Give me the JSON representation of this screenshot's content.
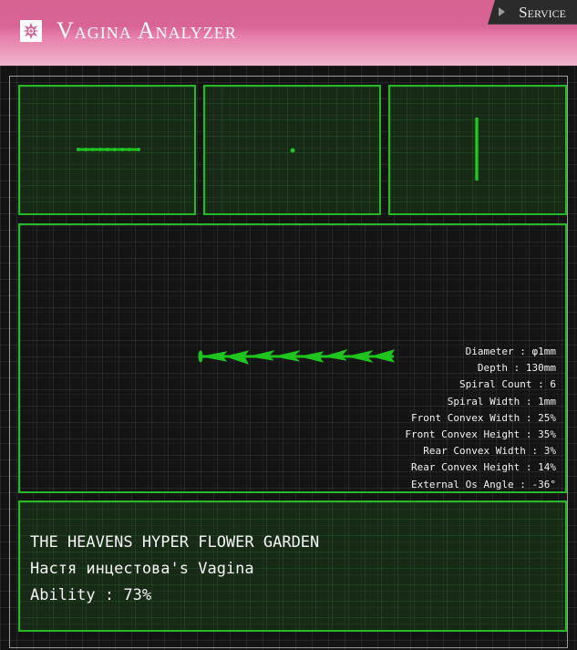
{
  "header": {
    "title": "Vagina Analyzer",
    "logo_icon": "flower-star-icon",
    "service_label": "Service",
    "colors": {
      "header_pink": "#d86495",
      "service_bg": "#2b2b2b"
    }
  },
  "views": {
    "colors": {
      "panel_border": "#27b827",
      "model": "#1fc41f"
    }
  },
  "specs": [
    {
      "label": "Diameter",
      "value": "φ1mm"
    },
    {
      "label": "Depth",
      "value": "130mm"
    },
    {
      "label": "Spiral Count",
      "value": "6"
    },
    {
      "label": "Spiral Width",
      "value": "1mm"
    },
    {
      "label": "Front Convex Width",
      "value": "25%"
    },
    {
      "label": "Front Convex Height",
      "value": "35%"
    },
    {
      "label": "Rear Convex Width",
      "value": "3%"
    },
    {
      "label": "Rear Convex Height",
      "value": "14%"
    },
    {
      "label": "External Os Angle",
      "value": "-36°"
    }
  ],
  "spec_lines": [
    "Diameter : φ1mm",
    "Depth : 130mm",
    "Spiral Count : 6",
    "Spiral Width : 1mm",
    "Front Convex Width : 25%",
    "Front Convex Height : 35%",
    "Rear Convex Width : 3%",
    "Rear Convex Height : 14%",
    "External Os Angle : -36°"
  ],
  "info": {
    "line1": "THE HEAVENS HYPER FLOWER GARDEN",
    "line2": "Настя инцестова's Vagina",
    "line3": "Ability : 73%"
  }
}
